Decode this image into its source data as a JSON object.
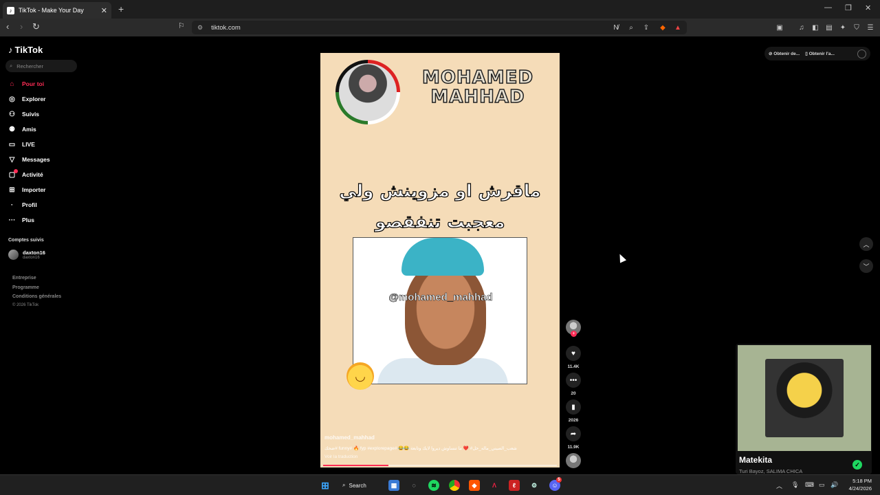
{
  "browser": {
    "tab_title": "TikTok - Make Your Day",
    "url": "tiktok.com"
  },
  "sidebar": {
    "logo": "TikTok",
    "search_placeholder": "Rechercher",
    "items": [
      {
        "label": "Pour toi",
        "icon": "home-icon"
      },
      {
        "label": "Explorer",
        "icon": "compass-icon"
      },
      {
        "label": "Suivis",
        "icon": "following-icon"
      },
      {
        "label": "Amis",
        "icon": "friends-icon"
      },
      {
        "label": "LIVE",
        "icon": "live-icon"
      },
      {
        "label": "Messages",
        "icon": "messages-icon"
      },
      {
        "label": "Activité",
        "icon": "activity-icon"
      },
      {
        "label": "Importer",
        "icon": "upload-icon"
      },
      {
        "label": "Profil",
        "icon": "profile-icon"
      },
      {
        "label": "Plus",
        "icon": "more-icon"
      }
    ],
    "followed_title": "Comptes suivis",
    "followed": {
      "name": "daxton16",
      "handle": "daxton16"
    },
    "footer": [
      "Entreprise",
      "Programme",
      "Conditions générales",
      "© 2026 TikTok"
    ]
  },
  "video": {
    "overlay_title_line1": "MOHAMED",
    "overlay_title_line2": "MAHHAD",
    "arabic_line1": "ماقرش او مزوينش ولي",
    "arabic_line2": "معجبت تنفقصو",
    "photo_handle": "@mohamed_mahhad",
    "username": "mohamed_mahhad",
    "description": "ضحك# funny# 🔥 fyp #explorepage# 😂😂 شعب_الصيني_ماله_حل# ❤️ ما تنساوش ديروا لايك وتابعة",
    "translate": "Voir la traduction",
    "progress": 0.28
  },
  "actions": {
    "likes": "11.4K",
    "comments": "20",
    "saves": "2026",
    "shares": "11.9K"
  },
  "top_right": {
    "pill1": "Obtenir de...",
    "pill2": "Obtenir l'a..."
  },
  "player": {
    "song": "Matekita",
    "artist": "Turi Bayoz, SALIMA CHICA"
  },
  "taskbar": {
    "search": "Search",
    "time": "5:18 PM",
    "date": "4/24/2026",
    "discord_badge": "5"
  },
  "colors": {
    "accent": "#fe2c55",
    "video_bg": "#f5dcb8",
    "player_bg": "#a7b493"
  }
}
